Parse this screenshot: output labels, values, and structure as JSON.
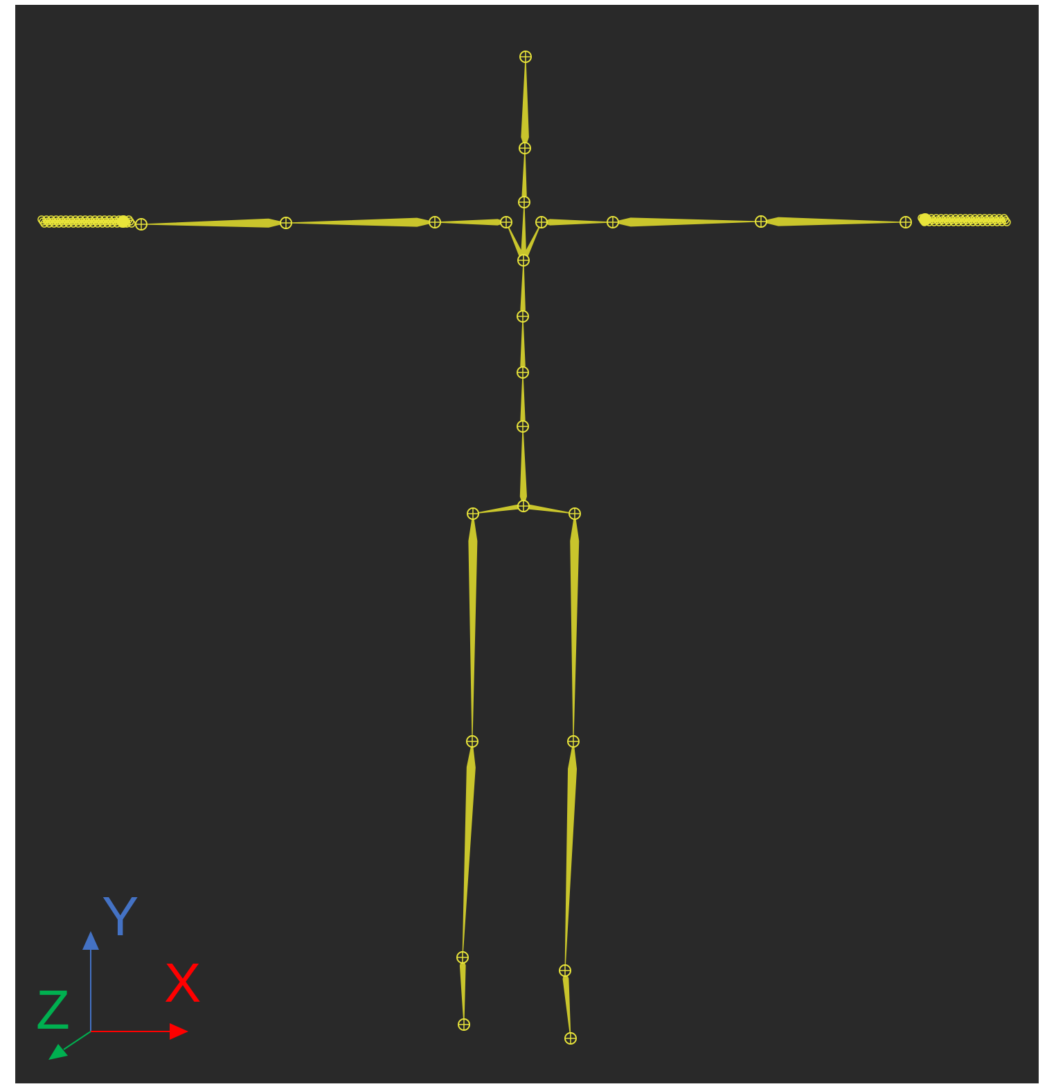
{
  "viewport": {
    "background": "#292929",
    "bone_color": "#c9c52c",
    "joint_color": "#e8e43a"
  },
  "skeleton": {
    "joints": [
      {
        "name": "head-top"
      },
      {
        "name": "head"
      },
      {
        "name": "neck"
      },
      {
        "name": "chest"
      },
      {
        "name": "spine-3"
      },
      {
        "name": "spine-2"
      },
      {
        "name": "spine-1"
      },
      {
        "name": "hips"
      },
      {
        "name": "left-clavicle"
      },
      {
        "name": "left-shoulder"
      },
      {
        "name": "left-elbow"
      },
      {
        "name": "left-wrist"
      },
      {
        "name": "right-clavicle"
      },
      {
        "name": "right-shoulder"
      },
      {
        "name": "right-elbow"
      },
      {
        "name": "right-wrist"
      },
      {
        "name": "left-upleg"
      },
      {
        "name": "left-knee"
      },
      {
        "name": "left-ankle"
      },
      {
        "name": "left-toe"
      },
      {
        "name": "right-upleg"
      },
      {
        "name": "right-knee"
      },
      {
        "name": "right-ankle"
      },
      {
        "name": "right-toe"
      }
    ]
  },
  "gizmo": {
    "y_label": "Y",
    "x_label": "X",
    "z_label": "Z",
    "y_color": "#4472c4",
    "x_color": "#ff0000",
    "z_color": "#00b050"
  }
}
